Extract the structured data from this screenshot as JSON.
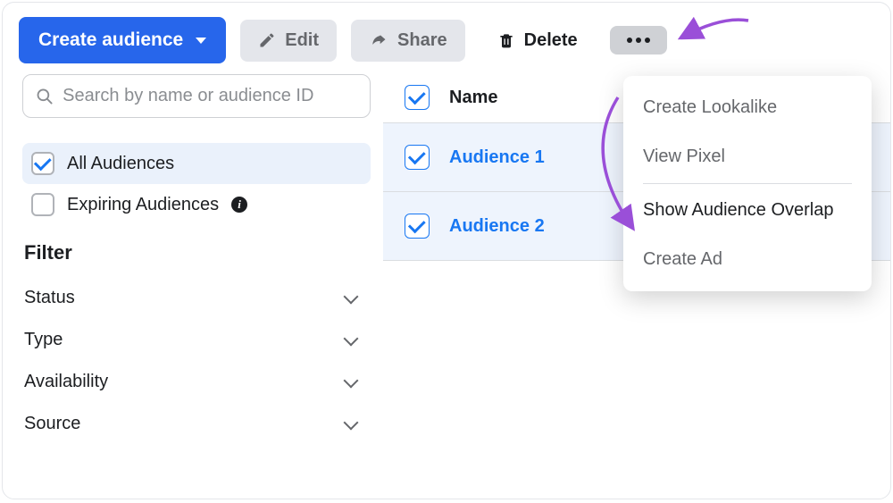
{
  "toolbar": {
    "create_label": "Create audience",
    "edit_label": "Edit",
    "share_label": "Share",
    "delete_label": "Delete"
  },
  "search": {
    "placeholder": "Search by name or audience ID"
  },
  "sidebar": {
    "items": [
      {
        "label": "All Audiences",
        "checked": true
      },
      {
        "label": "Expiring Audiences",
        "checked": false
      }
    ],
    "filter_heading": "Filter",
    "filters": [
      {
        "label": "Status"
      },
      {
        "label": "Type"
      },
      {
        "label": "Availability"
      },
      {
        "label": "Source"
      }
    ]
  },
  "table": {
    "header_name": "Name",
    "rows": [
      {
        "name": "Audience 1",
        "checked": true
      },
      {
        "name": "Audience 2",
        "checked": true
      }
    ]
  },
  "dropdown": {
    "items": [
      {
        "label": "Create Lookalike",
        "enabled": false
      },
      {
        "label": "View Pixel",
        "enabled": false
      },
      {
        "label": "Show Audience Overlap",
        "enabled": true
      },
      {
        "label": "Create Ad",
        "enabled": false
      }
    ]
  }
}
